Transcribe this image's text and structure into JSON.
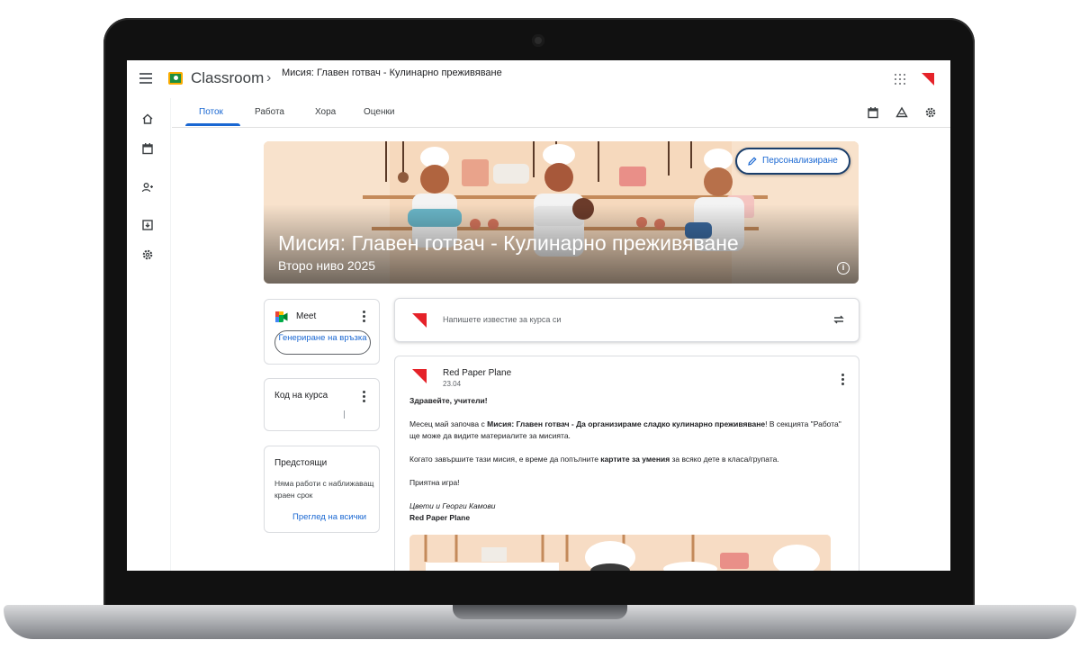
{
  "app": {
    "name": "Classroom",
    "breadcrumb": "Мисия: Главен готвач - Кулинарно преживяване"
  },
  "tabs": [
    {
      "label": "Поток",
      "active": true
    },
    {
      "label": "Работа",
      "active": false
    },
    {
      "label": "Хора",
      "active": false
    },
    {
      "label": "Оценки",
      "active": false
    }
  ],
  "toolbar_icons": [
    "calendar-icon",
    "drive-icon",
    "settings-icon"
  ],
  "rail_icons": [
    "home-icon",
    "calendar-icon",
    "people-icon",
    "archive-icon",
    "settings-icon"
  ],
  "banner": {
    "title": "Мисия: Главен готвач - Кулинарно преживяване",
    "subtitle": "Второ ниво 2025",
    "customize_label": "Персонализиране"
  },
  "meet": {
    "title": "Meet",
    "button_label": "Генериране на връзка"
  },
  "class_code": {
    "title": "Код на курса"
  },
  "upcoming": {
    "title": "Предстоящи",
    "empty_text": "Няма работи с наближаващ краен срок",
    "view_all": "Преглед на всички"
  },
  "announce": {
    "placeholder": "Напишете известие за курса си"
  },
  "post": {
    "author": "Red Paper Plane",
    "date": "23.04",
    "greeting": "Здравейте, учители!",
    "p1_start": "Месец май започва с ",
    "p1_bold": "Мисия: Главен готвач - Да организираме сладко кулинарно преживяване",
    "p1_end": "! В секцията \"Работа\" ще може да видите материалите за мисията.",
    "p2_start": "Когато завършите тази мисия, е време да попълните ",
    "p2_bold": "картите за умения",
    "p2_end": " за всяко дете в класа/групата.",
    "p3": "Приятна игра!",
    "signature": "Цвети и Георги Камови",
    "signature_org": "Red Paper Plane"
  },
  "colors": {
    "accent_blue": "#1967d2",
    "brand_red": "#e52229",
    "classroom_green": "#1e8e3e",
    "classroom_yellow": "#f9ab00"
  }
}
